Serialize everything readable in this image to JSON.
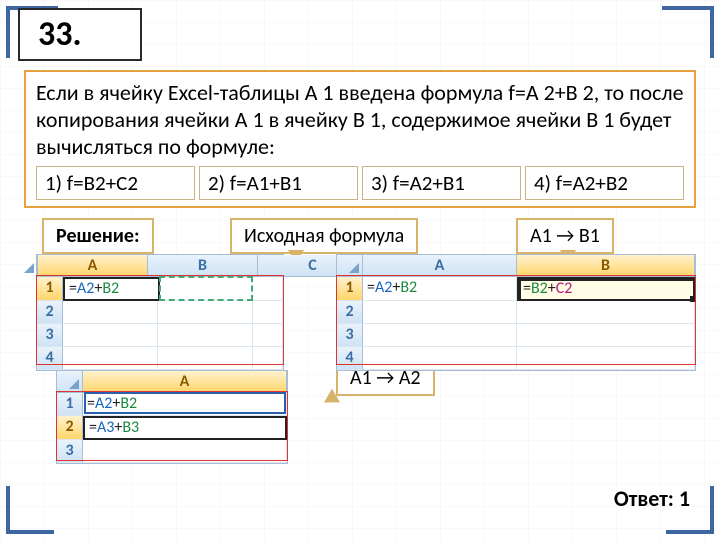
{
  "number": "33.",
  "question": "Если в ячейку Excel-таблицы A 1 введена формула f=A 2+B 2, то после копирования ячейки A 1 в ячейку B 1, содержимое ячейки B 1 будет вычисляться по формуле:",
  "options": {
    "o1": "1) f=B2+C2",
    "o2": "2) f=A1+B1",
    "o3": "3) f=A2+B1",
    "o4": "4) f=A2+B2"
  },
  "labels": {
    "solution": "Решение:",
    "initial_formula": "Исходная формула",
    "a1_to_b1": "A1 → B1",
    "a1_to_a2": "A1 → A2",
    "answer": "Ответ: 1"
  },
  "sheet1": {
    "cols": [
      "A",
      "B",
      "C"
    ],
    "rows": [
      "1",
      "2",
      "3",
      "4"
    ],
    "a1": {
      "eq": "=",
      "r1": "A2",
      "plus": "+",
      "r2": "B2"
    }
  },
  "sheet2": {
    "cols": [
      "A",
      "B"
    ],
    "rows": [
      "1",
      "2",
      "3",
      "4"
    ],
    "a1": {
      "eq": "=",
      "r1": "A2",
      "plus": "+",
      "r2": "B2"
    },
    "b1": {
      "eq": "=",
      "r1": "B2",
      "plus": "+",
      "r2": "C2"
    }
  },
  "sheet3": {
    "cols": [
      "A"
    ],
    "rows": [
      "1",
      "2",
      "3"
    ],
    "a1": {
      "eq": "=",
      "r1": "A2",
      "plus": "+",
      "r2": "B2"
    },
    "a2": {
      "eq": "=",
      "r1": "A3",
      "plus": "+",
      "r2": "B3"
    }
  }
}
